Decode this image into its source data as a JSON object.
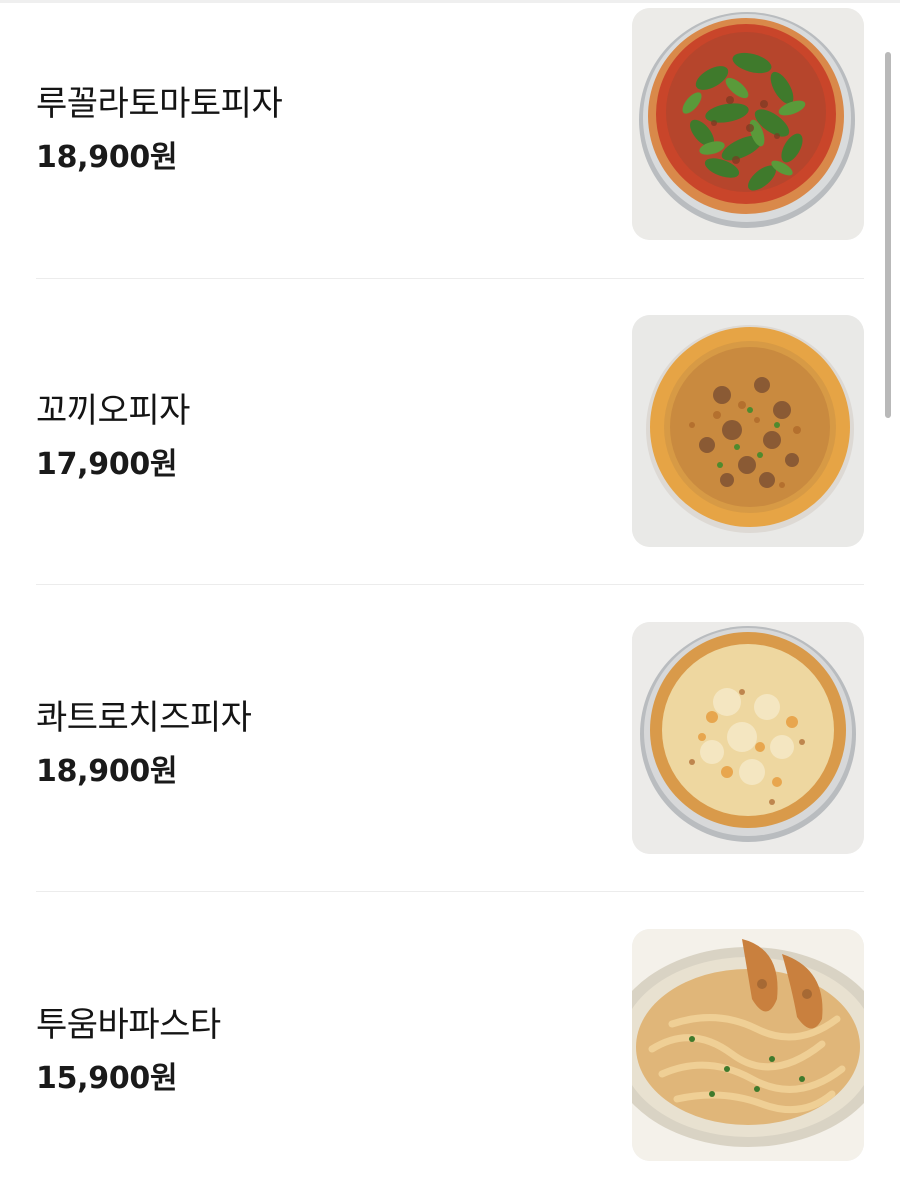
{
  "menu": {
    "items": [
      {
        "name": "루꼴라토마토피자",
        "price": "18,900원",
        "image": "arugula-tomato-pizza"
      },
      {
        "name": "꼬끼오피자",
        "price": "17,900원",
        "image": "chicken-pizza"
      },
      {
        "name": "콰트로치즈피자",
        "price": "18,900원",
        "image": "quattro-cheese-pizza"
      },
      {
        "name": "투움바파스타",
        "price": "15,900원",
        "image": "toowoomba-pasta"
      }
    ]
  },
  "colors": {
    "text": "#141414",
    "divider": "#ececec",
    "thumb_background": "#ececea",
    "scrollbar": "#b9b9b9"
  }
}
